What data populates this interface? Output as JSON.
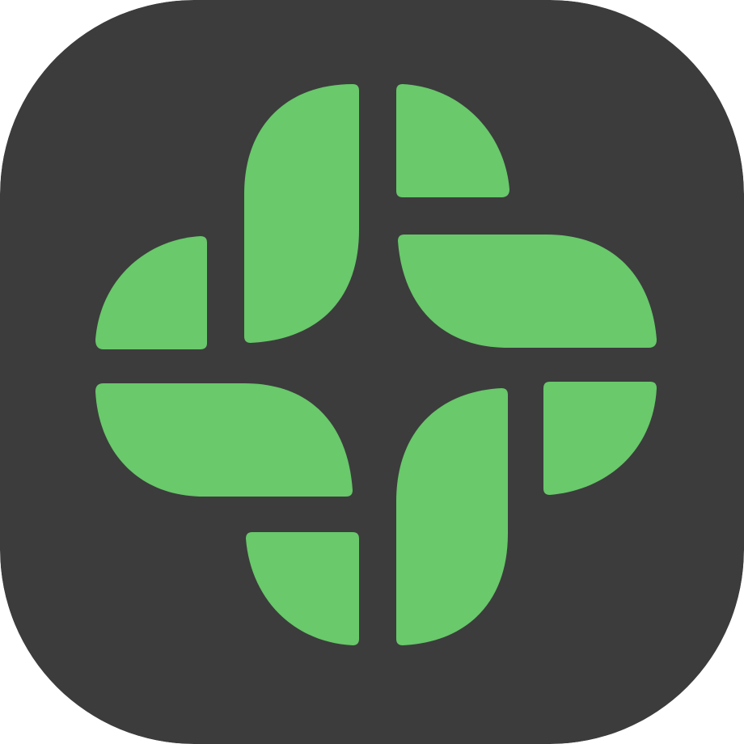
{
  "app_icon": {
    "icon": "green-cross-petals-icon",
    "colors": {
      "background": "#3c3c3c",
      "accent": "#69c96b"
    }
  }
}
